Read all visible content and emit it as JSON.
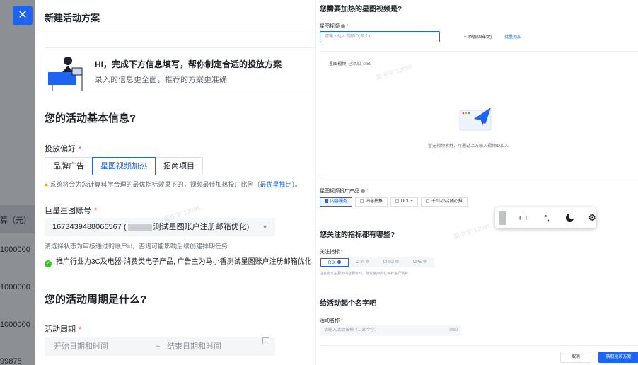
{
  "background": {
    "column_header": "算（元）",
    "values": [
      "1000000",
      "1000000",
      "1000000",
      "99875"
    ]
  },
  "close_label": "✕",
  "left": {
    "title": "新建活动方案",
    "hero": {
      "title": "HI，完成下方信息填写，帮你制定合适的投放方案",
      "subtitle": "录入的信息更全面，推荐的方案更准确"
    },
    "basic_heading": "您的活动基本信息?",
    "pref_label": "投放偏好",
    "pref_options": [
      "品牌广告",
      "星图视频加热",
      "招商项目"
    ],
    "pref_selected": 1,
    "pref_hint_prefix": "系统将会为您计算科学合理的最优指标效果下的，视频最佳加热投广比例（",
    "pref_hint_link": "最优星推比",
    "pref_hint_suffix": "）。",
    "account_label": "巨量星图账号",
    "account_value_prefix": "1673439488066567 (",
    "account_value_suffix": "测试星图账户注册邮箱优化)",
    "account_hint": "请选择状态为审核通过的账户id，否则可能影响后续创建排期任务",
    "account_ok": "推广行业为3C及电器-消费类电子产品, 广告主为马小香测试星图账户注册邮箱优化",
    "period_heading": "您的活动周期是什么?",
    "period_label": "活动周期",
    "start_placeholder": "开始日期和时间",
    "range_sep": "~",
    "end_placeholder": "结束日期和时间"
  },
  "right": {
    "video_heading": "您需要加热的星图视频是?",
    "video_label": "星图视频",
    "video_placeholder": "请输入达人视频ID(单个)",
    "add_label": "+ 添加(回车键)",
    "batch_label": "批量添加",
    "box_title": "星图视频",
    "box_count": "已添加: 0/50",
    "empty_text": "暂无视频素材，可通过上方输入视频ID加入",
    "product_label": "星图视频投广产品",
    "products": [
      "内容服务",
      "内容热推",
      "DOU+",
      "千川-小店随心推"
    ],
    "product_selected": 0,
    "metric_heading": "您关注的指标都有哪些?",
    "metric_label": "关注指标",
    "metrics": [
      "ROI",
      "CPA",
      "CPA3",
      "CPE"
    ],
    "metric_selected": 0,
    "metric_note": "注意模式主要为内容服务时，建议使用优化目标进行测算",
    "name_heading": "给活动起个名字吧",
    "name_label": "活动名称",
    "name_placeholder": "请输入活动名称（1-30个字）",
    "name_count": "0/30",
    "cancel_label": "取消",
    "submit_label": "获取投放方案"
  },
  "ime": {
    "lang": "中",
    "punct": "°,"
  },
  "watermark_text": "苗中宇 12095",
  "colors": {
    "primary": "#1d64f2",
    "required": "#f54a45",
    "success": "#34c724"
  }
}
